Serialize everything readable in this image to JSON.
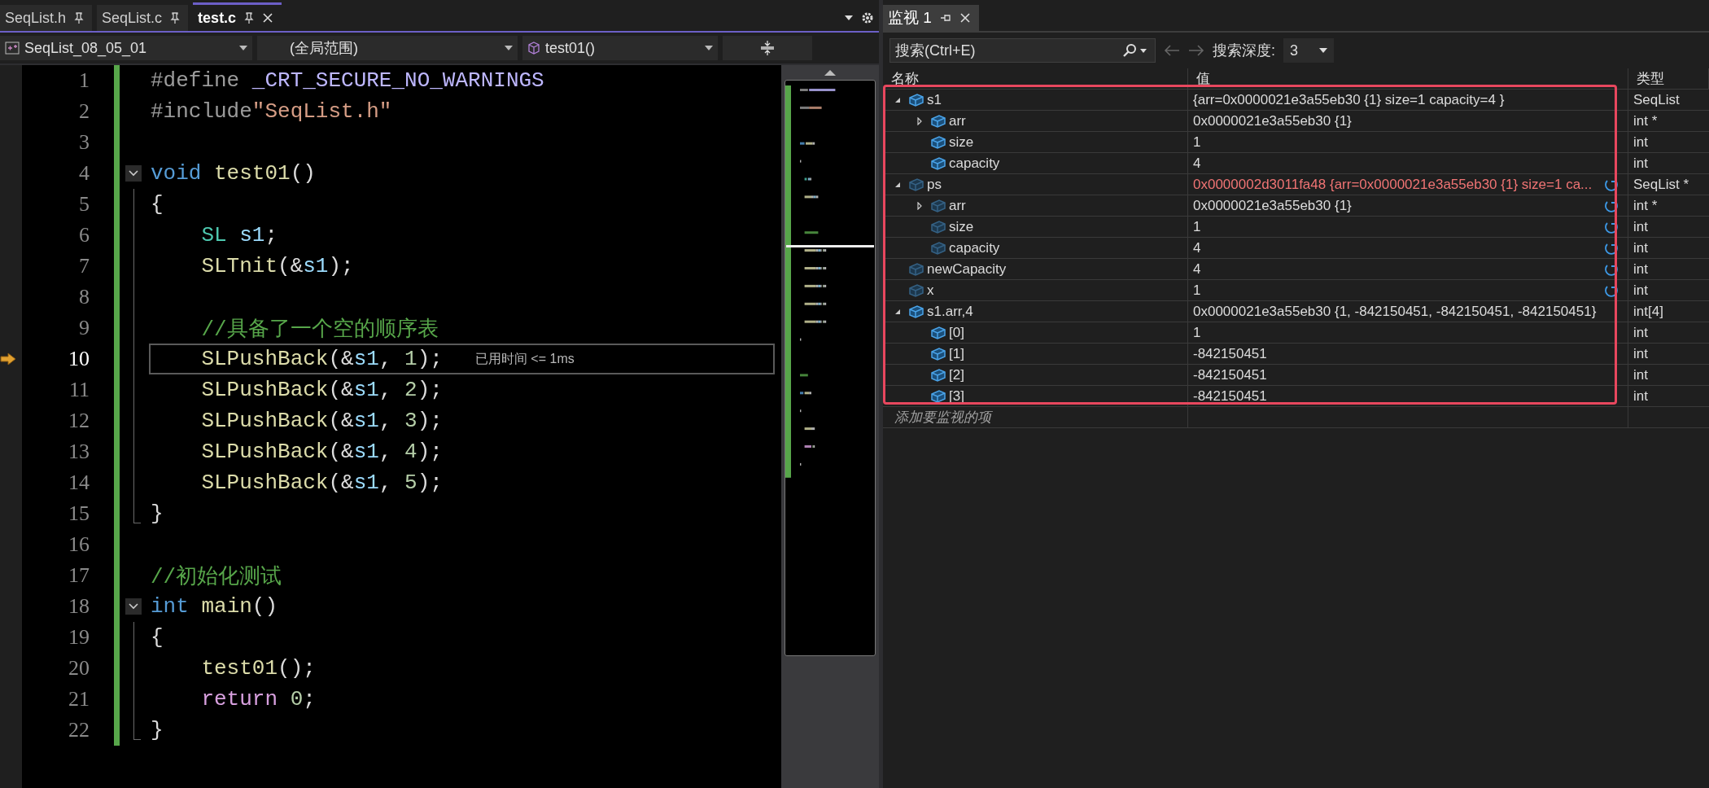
{
  "editor": {
    "tabs": [
      {
        "label": "SeqList.h",
        "selected": false,
        "pinned": true
      },
      {
        "label": "SeqList.c",
        "selected": false,
        "pinned": true
      },
      {
        "label": "test.c",
        "selected": true,
        "pinned": true
      }
    ],
    "nav": {
      "project": "SeqList_08_05_01",
      "scope": "(全局范围)",
      "member": "test01()"
    },
    "lines": [
      {
        "number": "1",
        "kind": "plain",
        "changed": true,
        "current": false,
        "tokens": [
          {
            "kind": "preproc",
            "text": "#define "
          },
          {
            "kind": "macro",
            "text": "_CRT_SECURE_NO_WARNINGS"
          }
        ]
      },
      {
        "number": "2",
        "kind": "plain",
        "changed": true,
        "current": false,
        "tokens": [
          {
            "kind": "preproc",
            "text": "#include"
          },
          {
            "kind": "string",
            "text": "\"SeqList.h\""
          }
        ]
      },
      {
        "number": "3",
        "kind": "plain",
        "changed": true,
        "current": false
      },
      {
        "number": "4",
        "kind": "fold_start",
        "changed": true,
        "current": false,
        "tokens": [
          {
            "kind": "keyword",
            "text": "void "
          },
          {
            "kind": "func",
            "text": "test01"
          },
          {
            "kind": "plain",
            "text": "()"
          }
        ]
      },
      {
        "number": "5",
        "kind": "block",
        "changed": true,
        "current": false,
        "tokens": [
          {
            "kind": "plain",
            "text": "{"
          }
        ]
      },
      {
        "number": "6",
        "kind": "block",
        "changed": true,
        "current": false,
        "tokens": [
          {
            "kind": "type",
            "text": "    SL "
          },
          {
            "kind": "var",
            "text": "s1"
          },
          {
            "kind": "plain",
            "text": ";"
          }
        ]
      },
      {
        "number": "7",
        "kind": "block",
        "changed": true,
        "current": false,
        "tokens": [
          {
            "kind": "func",
            "text": "    SLTnit"
          },
          {
            "kind": "plain",
            "text": "(&"
          },
          {
            "kind": "var",
            "text": "s1"
          },
          {
            "kind": "plain",
            "text": ");"
          }
        ]
      },
      {
        "number": "8",
        "kind": "block",
        "changed": true,
        "current": false
      },
      {
        "number": "9",
        "kind": "block",
        "changed": true,
        "current": false,
        "tokens": [
          {
            "kind": "comment",
            "text": "    //具备了一个空的顺序表"
          }
        ]
      },
      {
        "number": "10",
        "kind": "block",
        "changed": true,
        "current": true,
        "hint": "已用时间 <= 1ms",
        "tokens": [
          {
            "kind": "func",
            "text": "    SLPushBack"
          },
          {
            "kind": "plain",
            "text": "(&"
          },
          {
            "kind": "var",
            "text": "s1"
          },
          {
            "kind": "plain",
            "text": ", "
          },
          {
            "kind": "number",
            "text": "1"
          },
          {
            "kind": "plain",
            "text": ");"
          }
        ]
      },
      {
        "number": "11",
        "kind": "block",
        "changed": true,
        "current": false,
        "tokens": [
          {
            "kind": "func",
            "text": "    SLPushBack"
          },
          {
            "kind": "plain",
            "text": "(&"
          },
          {
            "kind": "var",
            "text": "s1"
          },
          {
            "kind": "plain",
            "text": ", "
          },
          {
            "kind": "number",
            "text": "2"
          },
          {
            "kind": "plain",
            "text": ");"
          }
        ]
      },
      {
        "number": "12",
        "kind": "block",
        "changed": true,
        "current": false,
        "tokens": [
          {
            "kind": "func",
            "text": "    SLPushBack"
          },
          {
            "kind": "plain",
            "text": "(&"
          },
          {
            "kind": "var",
            "text": "s1"
          },
          {
            "kind": "plain",
            "text": ", "
          },
          {
            "kind": "number",
            "text": "3"
          },
          {
            "kind": "plain",
            "text": ");"
          }
        ]
      },
      {
        "number": "13",
        "kind": "block",
        "changed": true,
        "current": false,
        "tokens": [
          {
            "kind": "func",
            "text": "    SLPushBack"
          },
          {
            "kind": "plain",
            "text": "(&"
          },
          {
            "kind": "var",
            "text": "s1"
          },
          {
            "kind": "plain",
            "text": ", "
          },
          {
            "kind": "number",
            "text": "4"
          },
          {
            "kind": "plain",
            "text": ");"
          }
        ]
      },
      {
        "number": "14",
        "kind": "block",
        "changed": true,
        "current": false,
        "tokens": [
          {
            "kind": "func",
            "text": "    SLPushBack"
          },
          {
            "kind": "plain",
            "text": "(&"
          },
          {
            "kind": "var",
            "text": "s1"
          },
          {
            "kind": "plain",
            "text": ", "
          },
          {
            "kind": "number",
            "text": "5"
          },
          {
            "kind": "plain",
            "text": ");"
          }
        ]
      },
      {
        "number": "15",
        "kind": "block_end",
        "changed": true,
        "current": false,
        "tokens": [
          {
            "kind": "plain",
            "text": "}"
          }
        ]
      },
      {
        "number": "16",
        "kind": "plain",
        "changed": true,
        "current": false
      },
      {
        "number": "17",
        "kind": "plain",
        "changed": true,
        "current": false,
        "tokens": [
          {
            "kind": "comment",
            "text": "//初始化测试"
          }
        ]
      },
      {
        "number": "18",
        "kind": "fold_start",
        "changed": true,
        "current": false,
        "tokens": [
          {
            "kind": "keyword",
            "text": "int "
          },
          {
            "kind": "func",
            "text": "main"
          },
          {
            "kind": "plain",
            "text": "()"
          }
        ]
      },
      {
        "number": "19",
        "kind": "block",
        "changed": true,
        "current": false,
        "tokens": [
          {
            "kind": "plain",
            "text": "{"
          }
        ]
      },
      {
        "number": "20",
        "kind": "block",
        "changed": true,
        "current": false,
        "tokens": [
          {
            "kind": "func",
            "text": "    test01"
          },
          {
            "kind": "plain",
            "text": "();"
          }
        ]
      },
      {
        "number": "21",
        "kind": "block",
        "changed": true,
        "current": false,
        "tokens": [
          {
            "kind": "control",
            "text": "    return "
          },
          {
            "kind": "number",
            "text": "0"
          },
          {
            "kind": "plain",
            "text": ";"
          }
        ]
      },
      {
        "number": "22",
        "kind": "block_end",
        "changed": true,
        "current": false,
        "tokens": [
          {
            "kind": "plain",
            "text": "}"
          }
        ]
      }
    ]
  },
  "watch": {
    "tab": "监视 1",
    "search": {
      "placeholder": "搜索(Ctrl+E)"
    },
    "depth_label": "搜索深度:",
    "depth": "3",
    "columns": [
      "名称",
      "值",
      "类型"
    ],
    "items": [
      {
        "name": "s1",
        "value": "{arr=0x0000021e3a55eb30 {1} size=1 capacity=4 }",
        "type": "SeqList",
        "changed": false,
        "stale": false,
        "expanded": true,
        "children": [
          {
            "name": "arr",
            "value": "0x0000021e3a55eb30 {1}",
            "type": "int *",
            "changed": false,
            "stale": false,
            "expanded": false
          },
          {
            "name": "size",
            "value": "1",
            "type": "int",
            "changed": false,
            "stale": false
          },
          {
            "name": "capacity",
            "value": "4",
            "type": "int",
            "changed": false,
            "stale": false
          }
        ]
      },
      {
        "name": "ps",
        "value": "0x0000002d3011fa48 {arr=0x0000021e3a55eb30 {1} size=1 ca...",
        "type": "SeqList *",
        "changed": true,
        "stale": true,
        "expanded": true,
        "children": [
          {
            "name": "arr",
            "value": "0x0000021e3a55eb30 {1}",
            "type": "int *",
            "changed": false,
            "stale": true,
            "expanded": false
          },
          {
            "name": "size",
            "value": "1",
            "type": "int",
            "changed": false,
            "stale": true
          },
          {
            "name": "capacity",
            "value": "4",
            "type": "int",
            "changed": false,
            "stale": true
          }
        ]
      },
      {
        "name": "newCapacity",
        "value": "4",
        "type": "int",
        "changed": false,
        "stale": true
      },
      {
        "name": "x",
        "value": "1",
        "type": "int",
        "changed": false,
        "stale": true
      },
      {
        "name": "s1.arr,4",
        "value": "0x0000021e3a55eb30 {1, -842150451, -842150451, -842150451}",
        "type": "int[4]",
        "changed": false,
        "stale": false,
        "expanded": true,
        "children": [
          {
            "name": "[0]",
            "value": "1",
            "type": "int",
            "changed": false,
            "stale": false
          },
          {
            "name": "[1]",
            "value": "-842150451",
            "type": "int",
            "changed": false,
            "stale": false
          },
          {
            "name": "[2]",
            "value": "-842150451",
            "type": "int",
            "changed": false,
            "stale": false
          },
          {
            "name": "[3]",
            "value": "-842150451",
            "type": "int",
            "changed": false,
            "stale": false
          }
        ]
      }
    ],
    "add_placeholder": "添加要监视的项"
  }
}
